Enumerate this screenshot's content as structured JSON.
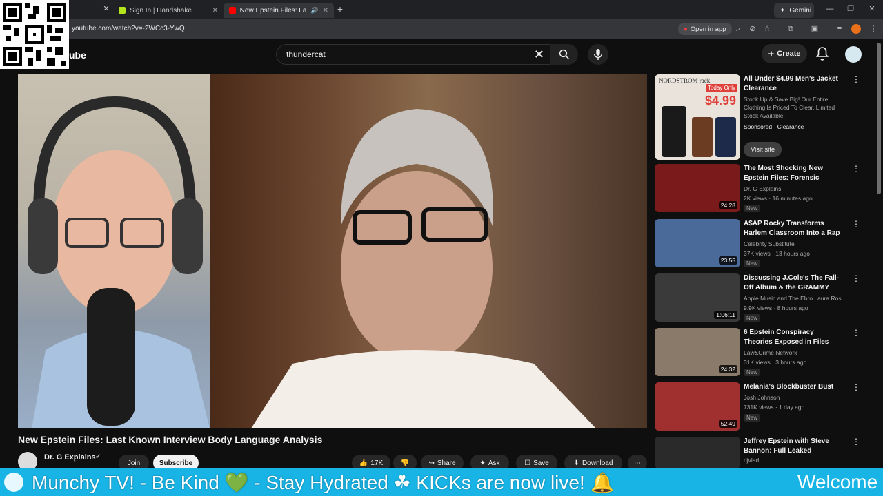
{
  "browser": {
    "tabs": [
      {
        "label": "Sign In | Handshake",
        "color": "#b5e61d"
      },
      {
        "label": "New Epstein Files: Last Kno",
        "color": "#ff0000"
      }
    ],
    "gemini_label": "Gemini",
    "url": "youtube.com/watch?v=-2WCc3-YwQ",
    "open_in_app": "Open in app"
  },
  "youtube": {
    "logo_text": "ube",
    "search_value": "thundercat",
    "create_label": "Create"
  },
  "video": {
    "title": "New Epstein Files: Last Known Interview Body Language Analysis",
    "channel": "Dr. G Explains",
    "join_label": "Join",
    "subscribe_label": "Subscribe",
    "likes": "17K",
    "share_label": "Share",
    "ask_label": "Ask",
    "save_label": "Save",
    "download_label": "Download"
  },
  "sidebar": {
    "ad": {
      "title": "All Under $4.99 Men's Jacket Clearance",
      "desc": "Stock Up & Save Big! Our Entire Clothing Is Priced To Clear. Limited Stock Available.",
      "sponsor": "Sponsored · Clearance",
      "visit": "Visit site",
      "thumb_text": "NORDSTROM rack",
      "thumb_badge": "Today Only",
      "thumb_price": "$4.99"
    },
    "items": [
      {
        "title": "The Most Shocking New Epstein Files: Forensic Expert ...",
        "channel": "Dr. G Explains",
        "meta": "2K views · 16 minutes ago",
        "badge": "New",
        "duration": "24:28",
        "thumb_color": "#7a1a1a"
      },
      {
        "title": "A$AP Rocky Transforms Harlem Classroom Into a Rap Video ...",
        "channel": "Celebrity Substitute",
        "meta": "37K views · 13 hours ago",
        "badge": "New",
        "duration": "23:55",
        "thumb_color": "#4a6a9a"
      },
      {
        "title": "Discussing J.Cole's The Fall-Off Album & the GRAMMY Awards...",
        "channel": "Apple Music",
        "channel_extra": "and The Ebro Laura Ros...",
        "meta": "9.9K views · 8 hours ago",
        "badge": "New",
        "duration": "1:06:11",
        "thumb_color": "#3a3a3a"
      },
      {
        "title": "6 Epstein Conspiracy Theories Exposed in Files Release",
        "channel": "Law&Crime Network",
        "meta": "31K views · 3 hours ago",
        "badge": "New",
        "duration": "24:32",
        "thumb_color": "#8a7a6a"
      },
      {
        "title": "Melania's Blockbuster Bust",
        "channel": "Josh Johnson",
        "meta": "731K views · 1 day ago",
        "badge": "New",
        "duration": "52:49",
        "thumb_color": "#a03030"
      },
      {
        "title": "Jeffrey Epstein with Steve Bannon: Full Leaked Interview",
        "channel": "djvlad",
        "meta": "",
        "badge": "",
        "duration": "",
        "thumb_color": "#2a2a2a"
      }
    ]
  },
  "ticker": {
    "text": "Munchy TV!  - Be Kind  💚  - Stay Hydrated  ☘  KICKs are now live!  🔔",
    "right": "Welcome"
  }
}
